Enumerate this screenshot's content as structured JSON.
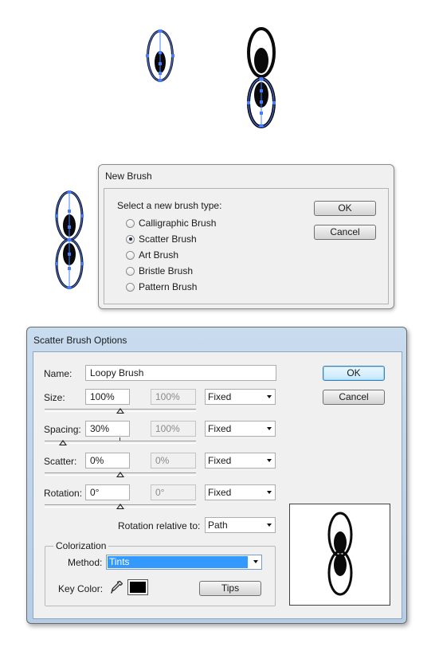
{
  "new_brush": {
    "title": "New Brush",
    "prompt": "Select a new brush type:",
    "options": [
      {
        "label": "Calligraphic Brush",
        "selected": false
      },
      {
        "label": "Scatter Brush",
        "selected": true
      },
      {
        "label": "Art Brush",
        "selected": false
      },
      {
        "label": "Bristle Brush",
        "selected": false
      },
      {
        "label": "Pattern Brush",
        "selected": false
      }
    ],
    "ok_label": "OK",
    "cancel_label": "Cancel"
  },
  "scatter": {
    "title": "Scatter Brush Options",
    "name_label": "Name:",
    "name_value": "Loopy Brush",
    "rows": [
      {
        "label": "Size:",
        "value": "100%",
        "value2": "100%",
        "method": "Fixed"
      },
      {
        "label": "Spacing:",
        "value": "30%",
        "value2": "100%",
        "method": "Fixed"
      },
      {
        "label": "Scatter:",
        "value": "0%",
        "value2": "0%",
        "method": "Fixed"
      },
      {
        "label": "Rotation:",
        "value": "0°",
        "value2": "0°",
        "method": "Fixed"
      }
    ],
    "rotation_relative_label": "Rotation relative to:",
    "rotation_relative_value": "Path",
    "colorization_label": "Colorization",
    "method_label": "Method:",
    "method_value": "Tints",
    "key_color_label": "Key Color:",
    "key_color": "#000000",
    "tips_label": "Tips",
    "ok_label": "OK",
    "cancel_label": "Cancel"
  },
  "colors": {
    "selection": "#4a7cff",
    "highlight": "#3399ff",
    "dialog_frame": "#c3d8ee"
  }
}
